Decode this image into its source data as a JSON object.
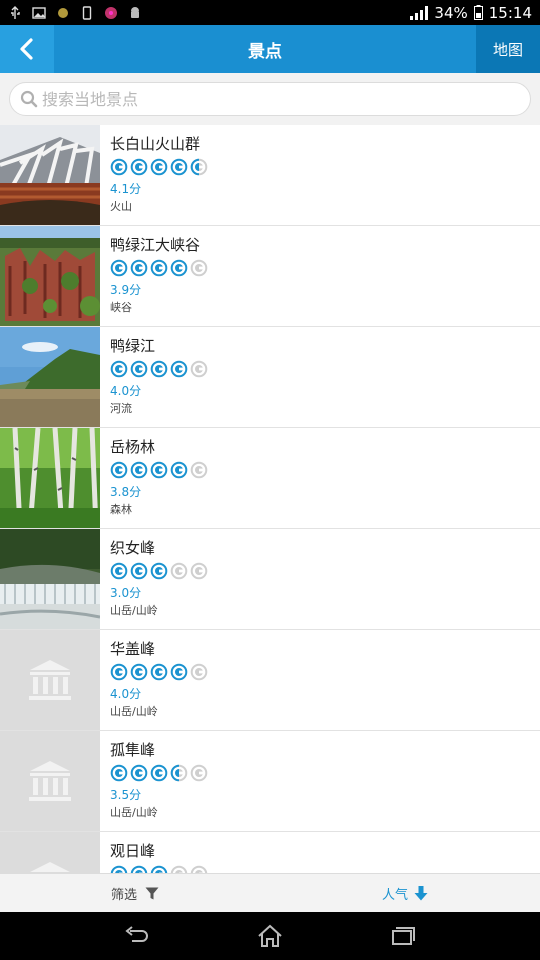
{
  "status_bar": {
    "battery": "34%",
    "time": "15:14",
    "icons": [
      "usb-icon",
      "image-icon",
      "notification-dot-icon",
      "phone-icon",
      "flower-icon",
      "android-icon",
      "signal-icon",
      "battery-icon"
    ]
  },
  "header": {
    "title": "景点",
    "map_label": "地图",
    "back_icon": "back-arrow-icon",
    "bg_color": "#1a8fd1"
  },
  "search": {
    "placeholder": "搜索当地景点",
    "value": ""
  },
  "spots": [
    {
      "name": "长白山火山群",
      "stars": 4.5,
      "score": "4.1分",
      "category": "火山",
      "thumb": "volcano"
    },
    {
      "name": "鸭绿江大峡谷",
      "stars": 4,
      "score": "3.9分",
      "category": "峡谷",
      "thumb": "canyon"
    },
    {
      "name": "鸭绿江",
      "stars": 4,
      "score": "4.0分",
      "category": "河流",
      "thumb": "river"
    },
    {
      "name": "岳杨林",
      "stars": 4,
      "score": "3.8分",
      "category": "森林",
      "thumb": "forest"
    },
    {
      "name": "织女峰",
      "stars": 3,
      "score": "3.0分",
      "category": "山岳/山岭",
      "thumb": "waterfall"
    },
    {
      "name": "华盖峰",
      "stars": 4,
      "score": "4.0分",
      "category": "山岳/山岭",
      "thumb": "placeholder"
    },
    {
      "name": "孤隼峰",
      "stars": 3.5,
      "score": "3.5分",
      "category": "山岳/山岭",
      "thumb": "placeholder"
    },
    {
      "name": "观日峰",
      "stars": 3,
      "score": "",
      "category": "",
      "thumb": "placeholder"
    }
  ],
  "bottom_bar": {
    "filter_label": "筛选",
    "sort_label": "人气"
  },
  "colors": {
    "accent": "#1b93d0",
    "star_empty": "#cfcfcf"
  }
}
